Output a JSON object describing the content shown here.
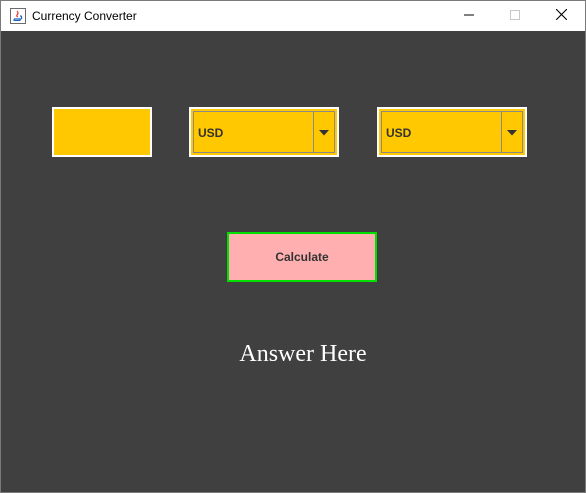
{
  "window": {
    "title": "Currency Converter",
    "controls": {
      "minimize_icon": "minimize-icon",
      "maximize_icon": "maximize-icon",
      "close_icon": "close-icon"
    }
  },
  "form": {
    "amount": {
      "value": ""
    },
    "from_currency": {
      "selected": "USD"
    },
    "to_currency": {
      "selected": "USD"
    },
    "calculate_label": "Calculate",
    "result_text": "Answer Here"
  },
  "colors": {
    "background": "#404040",
    "field_fill": "#ffc800",
    "button_fill": "#ffafaf",
    "button_border": "#00e000",
    "result_text": "#ffffff"
  }
}
